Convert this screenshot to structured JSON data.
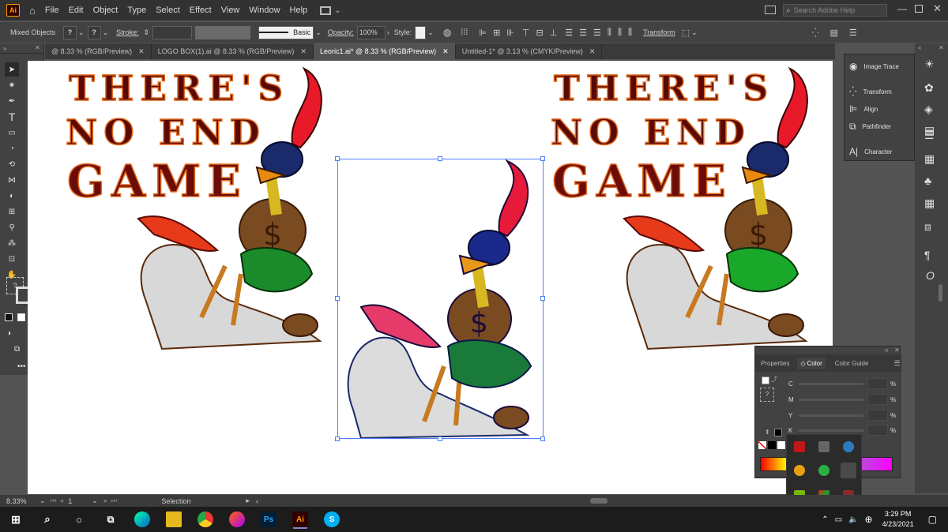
{
  "app": {
    "name": "Ai"
  },
  "menu": [
    "File",
    "Edit",
    "Object",
    "Type",
    "Select",
    "Effect",
    "View",
    "Window",
    "Help"
  ],
  "search": {
    "placeholder": "Search Adobe Help"
  },
  "control": {
    "selection_type": "Mixed Objects",
    "stroke_label": "Stroke:",
    "stroke_style": "Basic",
    "opacity_label": "Opacity:",
    "opacity_value": "100%",
    "style_label": "Style:",
    "transform_label": "Transform",
    "unknown": "?"
  },
  "tabs": [
    {
      "label": "@ 8.33 % (RGB/Preview)",
      "active": false
    },
    {
      "label": "LOGO BOX(1).ai @ 8.33 % (RGB/Preview)",
      "active": false
    },
    {
      "label": "Leoric1.ai* @ 8.33 % (RGB/Preview)",
      "active": true
    },
    {
      "label": "Untitled-1* @ 3.13 % (CMYK/Preview)",
      "active": false
    }
  ],
  "artwork": {
    "line1": "THERE'S",
    "line2": "NO END",
    "line3": "GAME"
  },
  "panels": {
    "items": [
      "Image Trace",
      "Transform",
      "Align",
      "Pathfinder",
      "Character"
    ]
  },
  "color_panel": {
    "tabs": [
      "Properties",
      "Color",
      "Color Guide"
    ],
    "channels": [
      "C",
      "M",
      "Y",
      "K"
    ],
    "percent": "%"
  },
  "status": {
    "zoom": "8.33%",
    "artboard": "1",
    "tool": "Selection"
  },
  "taskbar": {
    "time": "3:29 PM",
    "date": "4/23/2021"
  },
  "colors": {
    "accent": "#ff9a00",
    "canvas": "#ffffff",
    "selection": "#4d7fff"
  }
}
